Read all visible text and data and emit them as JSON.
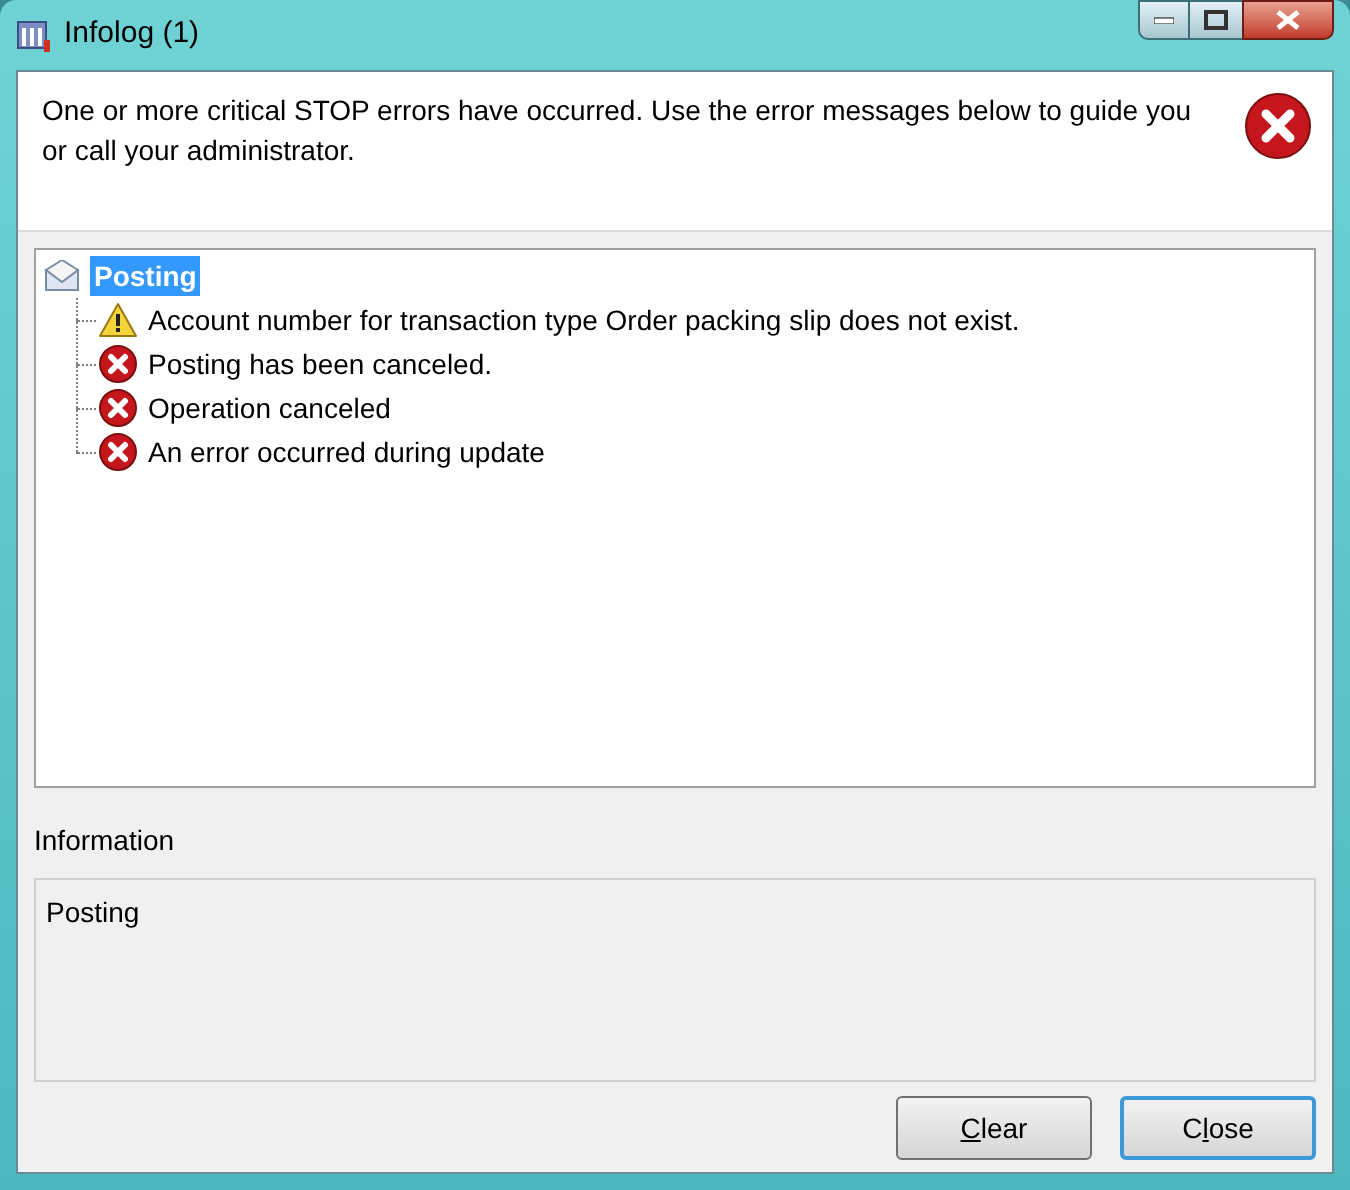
{
  "window": {
    "title": "Infolog (1)"
  },
  "message": "One or more critical STOP errors have occurred. Use the error messages below to guide you or call your administrator.",
  "tree": {
    "label": "Posting",
    "selected": true,
    "children": [
      {
        "kind": "warning",
        "label": "Account number for transaction type Order packing slip does not exist."
      },
      {
        "kind": "error",
        "label": "Posting has been canceled."
      },
      {
        "kind": "error",
        "label": "Operation canceled"
      },
      {
        "kind": "error",
        "label": "An error occurred during update"
      }
    ]
  },
  "information": {
    "heading": "Information",
    "text": "Posting"
  },
  "buttons": [
    {
      "access_key": "C",
      "after": "lear",
      "default": false
    },
    {
      "before": "C",
      "access_key": "l",
      "after": "ose",
      "default": true
    }
  ]
}
